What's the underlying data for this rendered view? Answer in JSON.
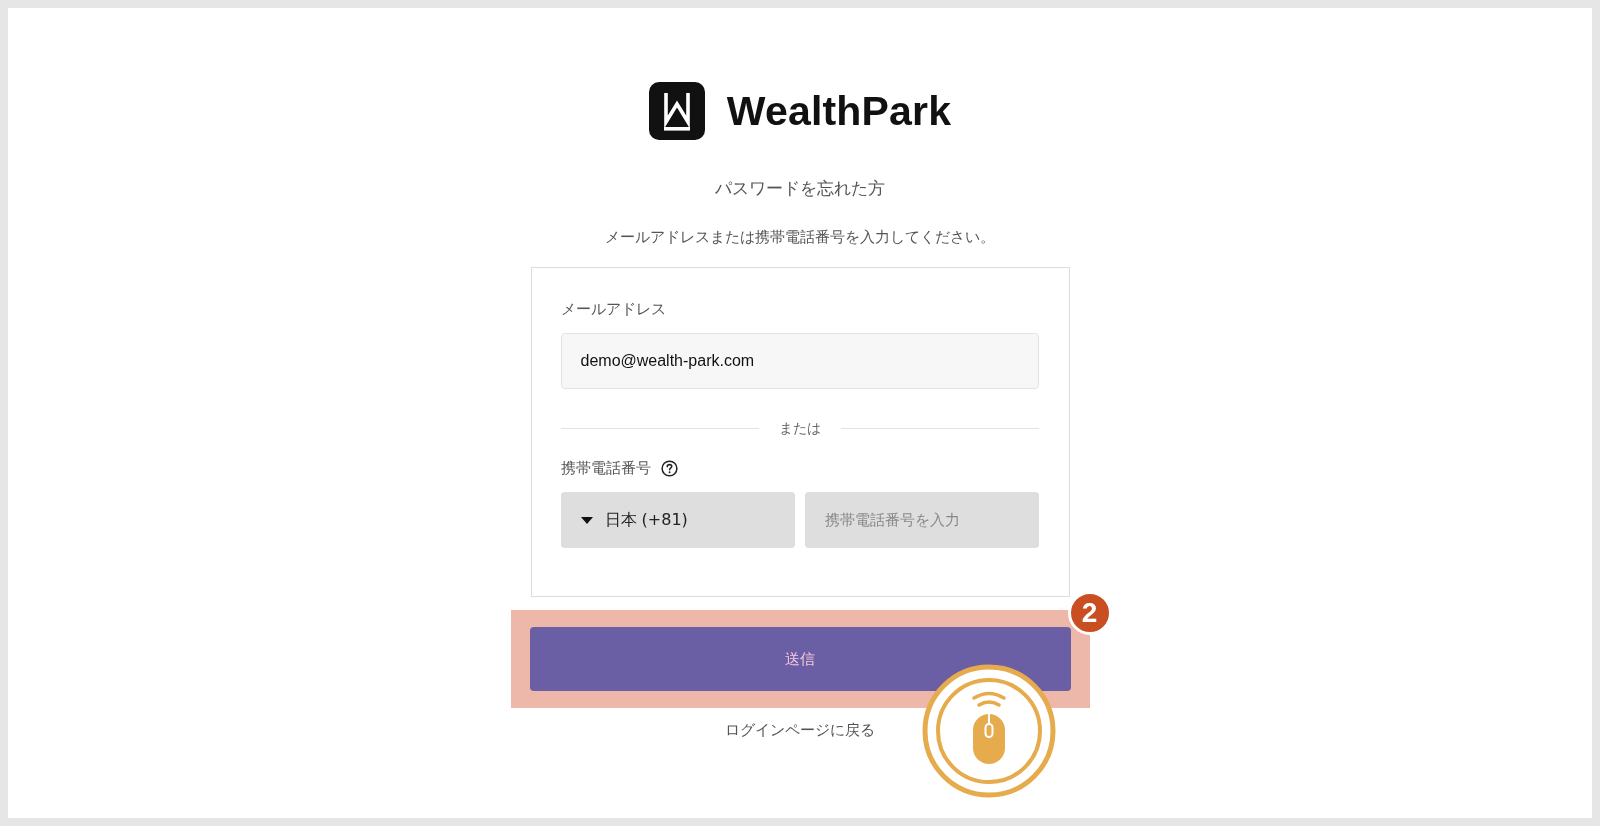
{
  "logo": {
    "text": "WealthPark"
  },
  "title": "パスワードを忘れた方",
  "instructions": "メールアドレスまたは携帯電話番号を入力してください。",
  "form": {
    "email": {
      "label": "メールアドレス",
      "value": "demo@wealth-park.com"
    },
    "divider": "または",
    "phone": {
      "label": "携帯電話番号",
      "country": "日本 (+81)",
      "placeholder": "携帯電話番号を入力"
    }
  },
  "submit_button": "送信",
  "back_link": "ログインページに戻る",
  "annotation": {
    "step": "2"
  }
}
